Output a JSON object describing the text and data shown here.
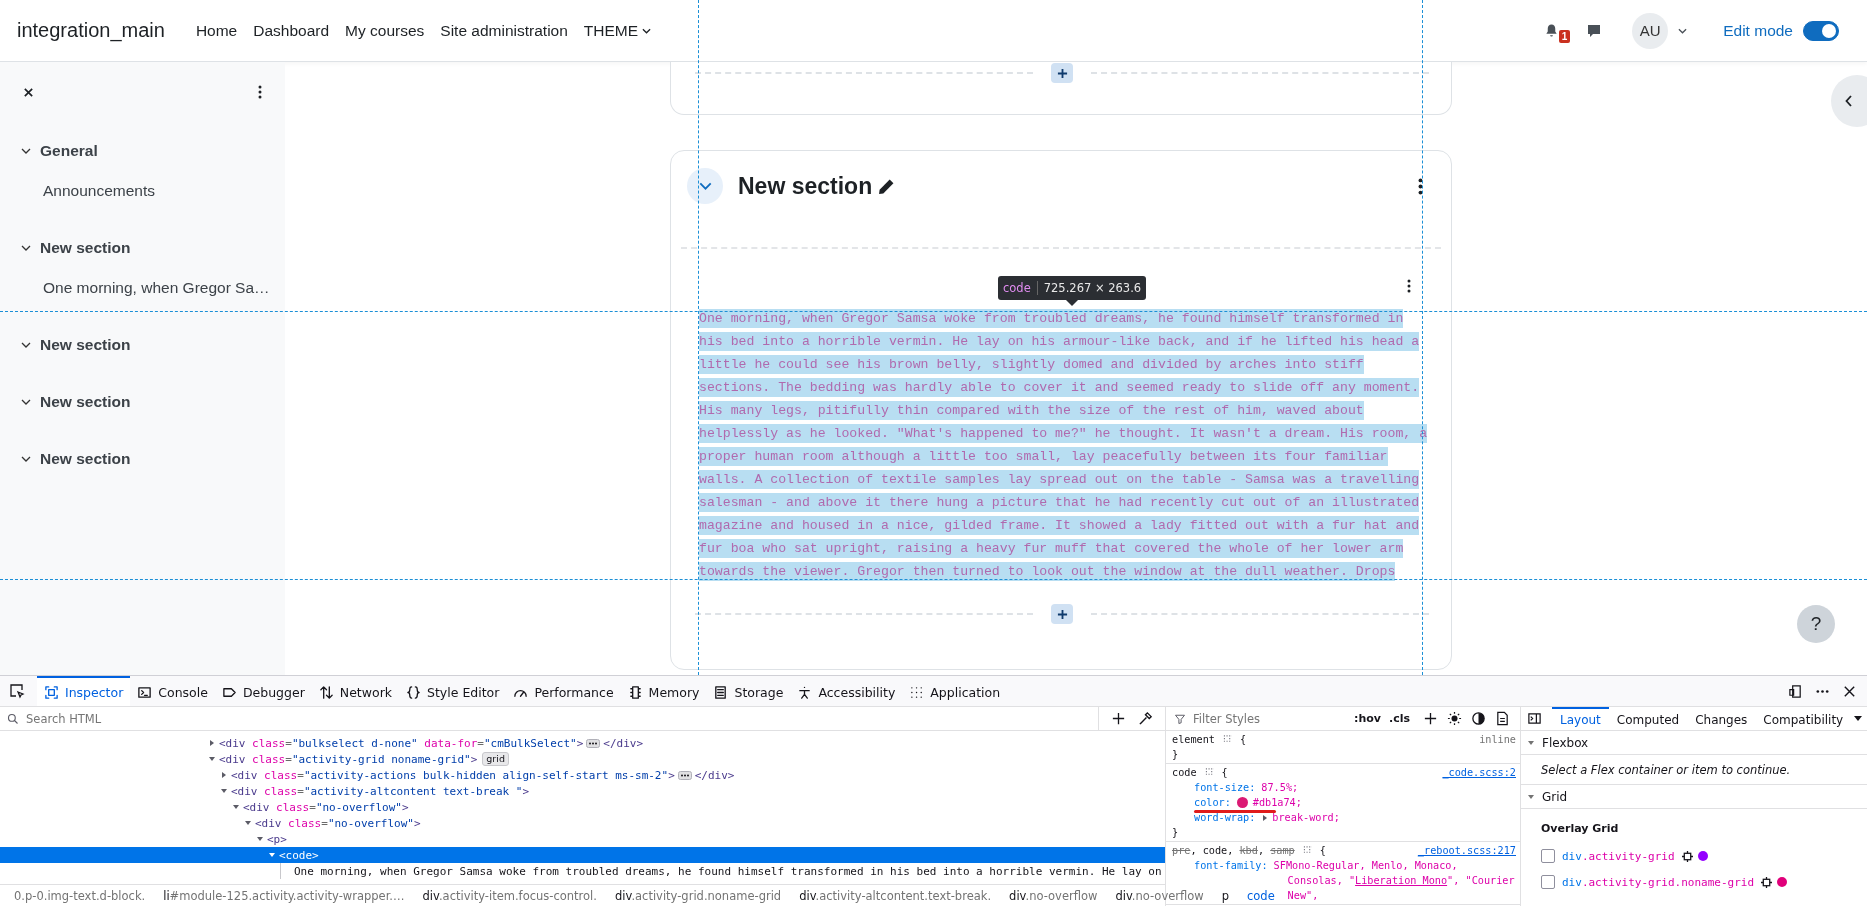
{
  "navbar": {
    "brand": "integration_main",
    "links": [
      {
        "label": "Home",
        "kind": "link"
      },
      {
        "label": "Dashboard",
        "kind": "link"
      },
      {
        "label": "My courses",
        "kind": "link"
      },
      {
        "label": "Site administration",
        "kind": "link"
      },
      {
        "label": "THEME",
        "kind": "dropdown"
      }
    ],
    "notification_count": "1",
    "avatar": "AU",
    "edit_mode": {
      "label": "Edit mode",
      "on": true
    }
  },
  "course_index": {
    "sections": [
      {
        "title": "General",
        "expanded": true,
        "items": [
          "Announcements"
        ]
      },
      {
        "title": "New section",
        "expanded": true,
        "items": [
          "One morning, when Gregor Sa…"
        ]
      },
      {
        "title": "New section",
        "expanded": true
      },
      {
        "title": "New section",
        "expanded": true
      },
      {
        "title": "New section",
        "expanded": true
      }
    ]
  },
  "content": {
    "section": {
      "title": "New section",
      "expanded": true,
      "code_lines": [
        "One morning, when Gregor Samsa woke from troubled dreams, he found himself transformed in",
        "his bed into a horrible vermin. He lay on his armour-like back, and if he lifted his head a",
        "little he could see his brown belly, slightly domed and divided by arches into stiff",
        "sections. The bedding was hardly able to cover it and seemed ready to slide off any moment.",
        "His many legs, pitifully thin compared with the size of the rest of him, waved about",
        "helplessly as he looked. \"What's happened to me?\" he thought. It wasn't a dream. His room, a",
        "proper human room although a little too small, lay peacefully between its four familiar",
        "walls. A collection of textile samples lay spread out on the table - Samsa was a travelling",
        "salesman - and above it there hung a picture that he had recently cut out of an illustrated",
        "magazine and housed in a nice, gilded frame. It showed a lady fitted out with a fur hat and",
        "fur boa who sat upright, raising a heavy fur muff that covered the whole of her lower arm",
        "towards the viewer. Gregor then turned to look out the window at the dull weather. Drops"
      ],
      "tooltip": {
        "tag": "code",
        "size": "725.267 × 263.6"
      }
    },
    "help": "?"
  },
  "devtools": {
    "tools": [
      {
        "label": "Inspector",
        "selected": true
      },
      {
        "label": "Console",
        "selected": false
      },
      {
        "label": "Debugger",
        "selected": false
      },
      {
        "label": "Network",
        "selected": false
      },
      {
        "label": "Style Editor",
        "selected": false
      },
      {
        "label": "Performance",
        "selected": false
      },
      {
        "label": "Memory",
        "selected": false
      },
      {
        "label": "Storage",
        "selected": false
      },
      {
        "label": "Accessibility",
        "selected": false
      },
      {
        "label": "Application",
        "selected": false
      }
    ],
    "search": {
      "placeholder": "Search HTML"
    },
    "markup": [
      {
        "kind": "element",
        "expanded": false,
        "selected": false,
        "tokens": [
          {
            "kind": "tag",
            "text": "<div"
          },
          {
            "kind": "attr",
            "text": " class"
          },
          {
            "kind": "punct",
            "text": "="
          },
          {
            "kind": "value",
            "text": "\"bulkselect d-none\""
          },
          {
            "kind": "attr",
            "text": " data-for"
          },
          {
            "kind": "punct",
            "text": "="
          },
          {
            "kind": "value",
            "text": "\"cmBulkSelect\""
          },
          {
            "kind": "tag",
            "text": ">"
          },
          {
            "kind": "more"
          },
          {
            "kind": "tag",
            "text": "</div>"
          }
        ]
      },
      {
        "kind": "element",
        "expanded": true,
        "selected": false,
        "tokens": [
          {
            "kind": "tag",
            "text": "<div"
          },
          {
            "kind": "attr",
            "text": " class"
          },
          {
            "kind": "punct",
            "text": "="
          },
          {
            "kind": "value",
            "text": "\"activity-grid noname-grid\""
          },
          {
            "kind": "tag",
            "text": ">"
          },
          {
            "kind": "badge",
            "text": "grid"
          }
        ],
        "children": [
          {
            "kind": "element",
            "expanded": false,
            "selected": false,
            "tokens": [
              {
                "kind": "tag",
                "text": "<div"
              },
              {
                "kind": "attr",
                "text": " class"
              },
              {
                "kind": "punct",
                "text": "="
              },
              {
                "kind": "value",
                "text": "\"activity-actions bulk-hidden align-self-start ms-sm-2\""
              },
              {
                "kind": "tag",
                "text": ">"
              },
              {
                "kind": "more"
              },
              {
                "kind": "tag",
                "text": "</div>"
              }
            ]
          },
          {
            "kind": "element",
            "expanded": true,
            "selected": false,
            "tokens": [
              {
                "kind": "tag",
                "text": "<div"
              },
              {
                "kind": "attr",
                "text": " class"
              },
              {
                "kind": "punct",
                "text": "="
              },
              {
                "kind": "value",
                "text": "\"activity-altcontent text-break \""
              },
              {
                "kind": "tag",
                "text": ">"
              }
            ],
            "children": [
              {
                "kind": "element",
                "expanded": true,
                "selected": false,
                "tokens": [
                  {
                    "kind": "tag",
                    "text": "<div"
                  },
                  {
                    "kind": "attr",
                    "text": " class"
                  },
                  {
                    "kind": "punct",
                    "text": "="
                  },
                  {
                    "kind": "value",
                    "text": "\"no-overflow\""
                  },
                  {
                    "kind": "tag",
                    "text": ">"
                  }
                ],
                "children": [
                  {
                    "kind": "element",
                    "expanded": true,
                    "selected": false,
                    "tokens": [
                      {
                        "kind": "tag",
                        "text": "<div"
                      },
                      {
                        "kind": "attr",
                        "text": " class"
                      },
                      {
                        "kind": "punct",
                        "text": "="
                      },
                      {
                        "kind": "value",
                        "text": "\"no-overflow\""
                      },
                      {
                        "kind": "tag",
                        "text": ">"
                      }
                    ],
                    "children": [
                      {
                        "kind": "element",
                        "expanded": true,
                        "selected": false,
                        "tokens": [
                          {
                            "kind": "tag",
                            "text": "<p>"
                          }
                        ],
                        "children": [
                          {
                            "kind": "element",
                            "expanded": true,
                            "selected": true,
                            "tokens": [
                              {
                                "kind": "tag",
                                "text": "<code>"
                              }
                            ],
                            "children": [
                              {
                                "kind": "text",
                                "tokens": [
                                  {
                                    "kind": "text",
                                    "text": "One morning, when Gregor Samsa woke from troubled dreams, he found himself transformed in his bed into a horrible vermin. He lay on"
                                  }
                                ]
                              }
                            ]
                          }
                        ]
                      }
                    ]
                  }
                ]
              }
            ]
          }
        ]
      }
    ],
    "breadcrumbs": [
      {
        "classes": "0.p-0.img-text.d-block.",
        "selected": false
      },
      {
        "tag": "li",
        "classes": "#module-125.activity.activity-wrapper.…",
        "selected": false
      },
      {
        "tag": "div",
        "classes": ".activity-item.focus-control.",
        "selected": false
      },
      {
        "tag": "div",
        "classes": ".activity-grid.noname-grid",
        "selected": false
      },
      {
        "tag": "div",
        "classes": ".activity-altcontent.text-break.",
        "selected": false
      },
      {
        "tag": "div",
        "classes": ".no-overflow",
        "selected": false
      },
      {
        "tag": "div",
        "classes": ".no-overflow",
        "selected": false
      },
      {
        "tag": "p",
        "selected": false
      },
      {
        "tag": "code",
        "selected": true
      }
    ],
    "styles": {
      "filter_placeholder": "Filter Styles",
      "buttons": [
        ":hov",
        ".cls"
      ],
      "rules": [
        {
          "selectors": [
            {
              "text": "element",
              "struck": false
            }
          ],
          "open": "{",
          "close": "}",
          "source": "inline",
          "link": false
        },
        {
          "selectors": [
            {
              "text": "code",
              "struck": false
            }
          ],
          "open": "{",
          "close": "}",
          "source": "_code.scss:2",
          "link": true,
          "declarations": [
            {
              "property": "font-size:",
              "expandable": false,
              "highlighted": false,
              "value": [
                {
                  "text": "87.5%;",
                  "underlined": false
                }
              ]
            },
            {
              "property": "color:",
              "color": "#db1a74",
              "expandable": false,
              "highlighted": true,
              "value": [
                {
                  "text": "#db1a74;",
                  "underlined": false
                }
              ]
            },
            {
              "property": "word-wrap:",
              "expandable": true,
              "highlighted": false,
              "value": [
                {
                  "text": "break-word;",
                  "underlined": false
                }
              ]
            }
          ]
        },
        {
          "selectors": [
            {
              "text": "pre",
              "struck": true
            },
            {
              "text": ", code, ",
              "struck": false
            },
            {
              "text": "kbd",
              "struck": true
            },
            {
              "text": ", ",
              "struck": false
            },
            {
              "text": "samp",
              "struck": true
            }
          ],
          "open": "{",
          "source": "_reboot.scss:217",
          "link": true,
          "declarations": [
            {
              "property": "font-family:",
              "expandable": false,
              "highlighted": false,
              "value": [
                {
                  "text": "SFMono-Regular, Menlo, Monaco, Consolas, \"",
                  "underlined": false
                },
                {
                  "text": "Liberation Mono",
                  "underlined": true
                },
                {
                  "text": "\", \"Courier New\",",
                  "underlined": false
                }
              ]
            }
          ]
        }
      ]
    },
    "sidebar_tabs": [
      {
        "label": "Layout",
        "selected": true
      },
      {
        "label": "Computed",
        "selected": false
      },
      {
        "label": "Changes",
        "selected": false
      },
      {
        "label": "Compatibility",
        "selected": false
      }
    ],
    "layout_sections": [
      {
        "title": "Flexbox",
        "expanded": true,
        "message": "Select a Flex container or item to continue."
      },
      {
        "title": "Grid",
        "expanded": true,
        "subtitle": "Overlay Grid",
        "grids": [
          {
            "tag": "div",
            "classes": ".activity-grid",
            "checked": false,
            "color": "#9400ff"
          },
          {
            "tag": "div",
            "classes": ".activity-grid.noname-grid",
            "checked": false,
            "color": "#e0007a"
          }
        ]
      }
    ]
  }
}
